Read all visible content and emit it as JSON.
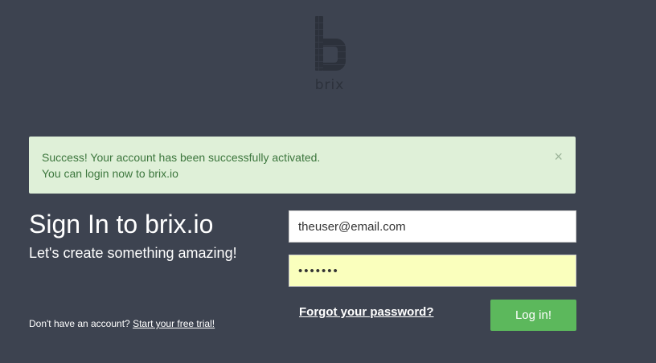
{
  "logo": {
    "text": "brix"
  },
  "alert": {
    "line1": "Success! Your account has been successfully activated.",
    "line2": "You can login now to brix.io",
    "close_symbol": "×"
  },
  "signin": {
    "heading": "Sign In to brix.io",
    "subheading": "Let's create something amazing!"
  },
  "signup": {
    "prompt": "Don't have an account?",
    "link_label": "Start your free trial!"
  },
  "form": {
    "email_value": "theuser@email.com",
    "password_value": "•••••••",
    "forgot_label": "Forgot your password?",
    "login_label": "Log in!"
  },
  "colors": {
    "background": "#3d4350",
    "alert_bg": "#dff0d8",
    "alert_text": "#3c763d",
    "login_button": "#5cb85c",
    "password_bg": "#faffbd"
  }
}
